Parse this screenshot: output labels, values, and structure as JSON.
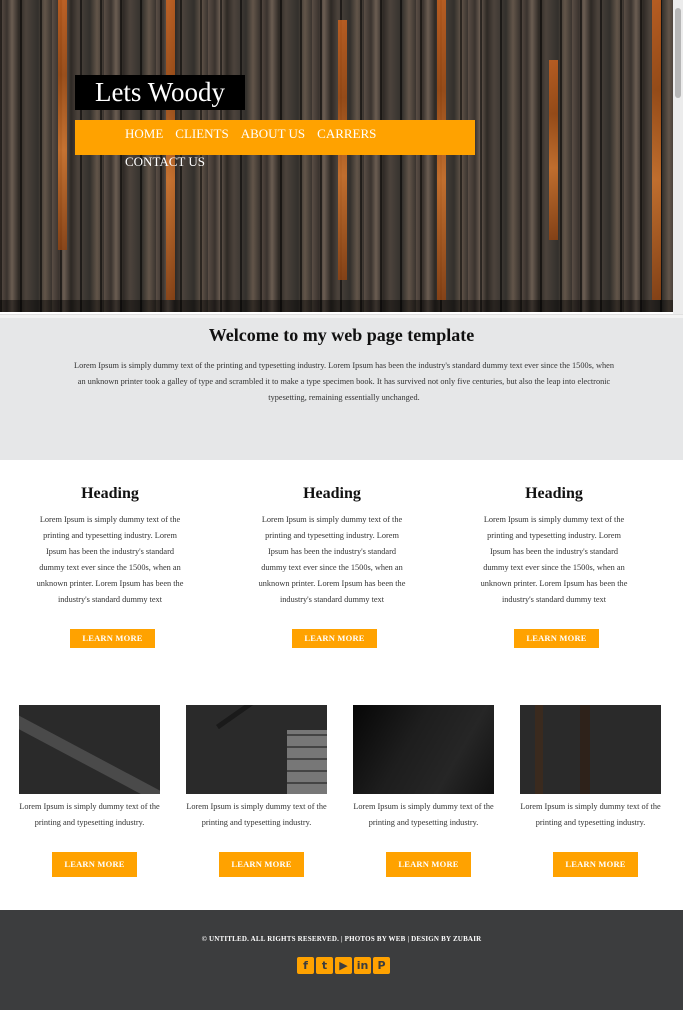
{
  "site": {
    "logo": "Lets Woody",
    "nav": [
      "HOME",
      "CLIENTS",
      "ABOUT US",
      "CARRERS",
      "CONTACT US"
    ]
  },
  "welcome": {
    "title": "Welcome to my web page template",
    "body": "Lorem Ipsum is simply dummy text of the printing and typesetting industry. Lorem Ipsum has been the industry's standard dummy text ever since the 1500s, when an unknown printer took a galley of type and scrambled it to make a type specimen book. It has survived not only five centuries, but also the leap into electronic typesetting, remaining essentially unchanged."
  },
  "features": [
    {
      "heading": "Heading",
      "text": "Lorem Ipsum is simply dummy text of the printing and typesetting industry. Lorem Ipsum has been the industry's standard dummy text ever since the 1500s, when an unknown printer. Lorem Ipsum has been the industry's standard dummy text",
      "button": "LEARN MORE"
    },
    {
      "heading": "Heading",
      "text": "Lorem Ipsum is simply dummy text of the printing and typesetting industry. Lorem Ipsum has been the industry's standard dummy text ever since the 1500s, when an unknown printer. Lorem Ipsum has been the industry's standard dummy text",
      "button": "LEARN MORE"
    },
    {
      "heading": "Heading",
      "text": "Lorem Ipsum is simply dummy text of the printing and typesetting industry. Lorem Ipsum has been the industry's standard dummy text ever since the 1500s, when an unknown printer. Lorem Ipsum has been the industry's standard dummy text",
      "button": "LEARN MORE"
    }
  ],
  "cards": [
    {
      "text": "Lorem Ipsum is simply dummy text of the printing and typesetting industry.",
      "button": "LEARN MORE"
    },
    {
      "text": "Lorem Ipsum is simply dummy text of the printing and typesetting industry.",
      "button": "LEARN MORE"
    },
    {
      "text": "Lorem Ipsum is simply dummy text of the printing and typesetting industry.",
      "button": "LEARN MORE"
    },
    {
      "text": "Lorem Ipsum is simply dummy text of the printing and typesetting industry.",
      "button": "LEARN MORE"
    }
  ],
  "footer": {
    "copyright": "© UNTITLED. ALL RIGHTS RESERVED. | PHOTOS BY WEB | DESIGN BY ZUBAIR",
    "social_icons": [
      "facebook-icon",
      "twitter-icon",
      "youtube-icon",
      "linkedin-icon",
      "pinterest-icon"
    ],
    "social_glyphs": [
      "f",
      "t",
      "▶",
      "in",
      "P"
    ]
  },
  "colors": {
    "accent": "#ffa200",
    "footer_bg": "#3c3d3e",
    "welcome_bg": "#e6e7e8",
    "logo_bg": "#000000"
  }
}
